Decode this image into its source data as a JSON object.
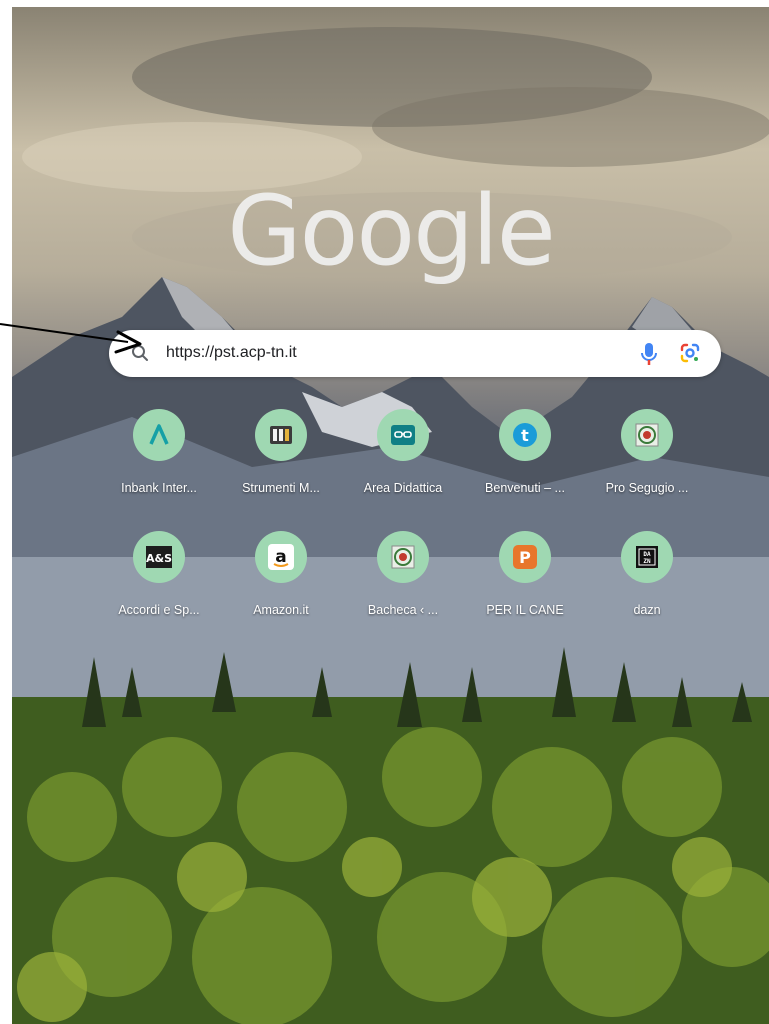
{
  "page": {
    "logo_text": "Google",
    "search": {
      "value": "https://pst.acp-tn.it"
    }
  },
  "shortcuts": [
    {
      "label": "Inbank Inter...",
      "icon": "inbank-icon"
    },
    {
      "label": "Strumenti M...",
      "icon": "piano-icon"
    },
    {
      "label": "Area Didattica",
      "icon": "area-didattica-icon"
    },
    {
      "label": "Benvenuti – ...",
      "icon": "t-logo-icon"
    },
    {
      "label": "Pro Segugio ...",
      "icon": "emblem-icon"
    },
    {
      "label": "Accordi e Sp...",
      "icon": "aes-logo-icon"
    },
    {
      "label": "Amazon.it",
      "icon": "amazon-icon"
    },
    {
      "label": "Bacheca ‹ ...",
      "icon": "emblem-icon"
    },
    {
      "label": "PER IL CANE",
      "icon": "per-il-cane-icon"
    },
    {
      "label": "dazn",
      "icon": "dazn-icon"
    }
  ],
  "colors": {
    "tile_circle": "#9fd8b2",
    "mic_blue": "#4285f4",
    "mic_red": "#ea4335"
  }
}
